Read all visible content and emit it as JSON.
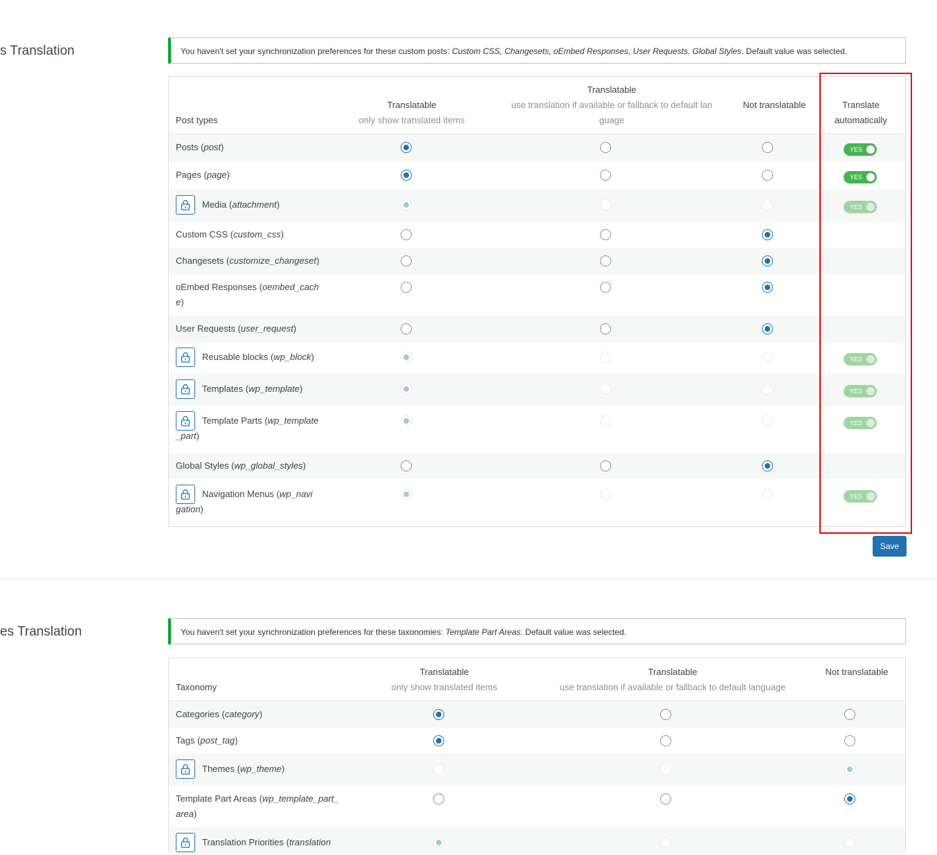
{
  "sections": {
    "post_types_title": "s Translation",
    "taxonomies_title": "es Translation"
  },
  "post_notice": {
    "prefix": "You haven't set your synchronization preferences for these custom posts: ",
    "items": "Custom CSS, Changesets, oEmbed Responses, User Requests, Global Styles",
    "suffix": ". Default value was selected."
  },
  "post_table": {
    "headers": {
      "col0": "Post types",
      "col1_title": "Translatable",
      "col1_sub": "only show translated items",
      "col2_title": "Translatable",
      "col2_sub_line1": "use translation if available or fallback to default lan",
      "col2_sub_line2": "guage",
      "col3_title": "Not translatable",
      "col4_line1": "Translate",
      "col4_line2": "automatically"
    },
    "rows": [
      {
        "label": "Posts (",
        "slug": "post",
        "close": ")",
        "selected": 0,
        "locked": false,
        "auto": "YES"
      },
      {
        "label": "Pages (",
        "slug": "page",
        "close": ")",
        "selected": 0,
        "locked": false,
        "auto": "YES"
      },
      {
        "label": "Media (",
        "slug": "attachment",
        "close": ")",
        "selected": 0,
        "locked": true,
        "auto": "YES"
      },
      {
        "label": "Custom CSS (",
        "slug": "custom_css",
        "close": ")",
        "selected": 2,
        "locked": false,
        "auto": ""
      },
      {
        "label": "Changesets (",
        "slug": "customize_changeset",
        "close": ")",
        "selected": 2,
        "locked": false,
        "auto": ""
      },
      {
        "label": "oEmbed Responses (",
        "slug": "oembed_cach",
        "line2slug": "e",
        "close": ")",
        "selected": 2,
        "locked": false,
        "auto": ""
      },
      {
        "label": "User Requests (",
        "slug": "user_request",
        "close": ")",
        "selected": 2,
        "locked": false,
        "auto": ""
      },
      {
        "label": "Reusable blocks (",
        "slug": "wp_block",
        "close": ")",
        "selected": 0,
        "locked": true,
        "auto": "YES"
      },
      {
        "label": "Templates (",
        "slug": "wp_template",
        "close": ")",
        "selected": 0,
        "locked": true,
        "auto": "YES"
      },
      {
        "label": "Template Parts (",
        "slug": "wp_template",
        "line2slug": "_part",
        "close": ")",
        "selected": 0,
        "locked": true,
        "auto": "YES"
      },
      {
        "label": "Global Styles (",
        "slug": "wp_global_styles",
        "close": ")",
        "selected": 2,
        "locked": false,
        "auto": ""
      },
      {
        "label": "Navigation Menus (",
        "slug": "wp_navi",
        "line2slug": "gation",
        "close": ")",
        "selected": 0,
        "locked": true,
        "auto": "YES"
      }
    ]
  },
  "save_label": "Save",
  "tax_notice": {
    "prefix": "You haven't set your synchronization preferences for these taxonomies: ",
    "items": "Template Part Areas",
    "suffix": ". Default value was selected."
  },
  "tax_table": {
    "headers": {
      "col0": "Taxonomy",
      "col1_title": "Translatable",
      "col1_sub": "only show translated items",
      "col2_title": "Translatable",
      "col2_sub": "use translation if available or fallback to default language",
      "col3_title": "Not translatable"
    },
    "rows": [
      {
        "label": "Categories (",
        "slug": "category",
        "close": ")",
        "selected": 0,
        "locked": false
      },
      {
        "label": "Tags (",
        "slug": "post_tag",
        "close": ")",
        "selected": 0,
        "locked": false
      },
      {
        "label": "Themes (",
        "slug": "wp_theme",
        "close": ")",
        "selected": 2,
        "locked": true
      },
      {
        "label": "Template Part Areas (",
        "slug": "wp_template_part_",
        "line2slug": "area",
        "close": ")",
        "selected": 2,
        "locked": false
      },
      {
        "label": "Translation Priorities (",
        "slug": "translation",
        "close": "",
        "selected": 0,
        "locked": true
      }
    ]
  },
  "colors": {
    "accent": "#2271b1",
    "notice_border": "#00a32a",
    "toggle_on": "#46b450",
    "highlight": "#ee0000"
  }
}
